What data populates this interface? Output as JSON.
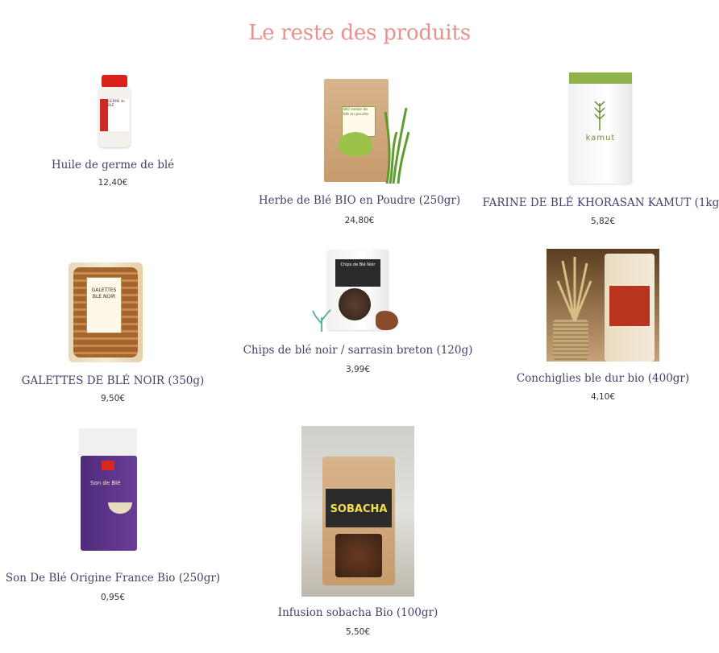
{
  "section": {
    "title": "Le reste des produits"
  },
  "products": [
    {
      "name": "Huile de germe de blé",
      "price": "12,40€",
      "image_label": "GERME de BLÉ"
    },
    {
      "name": "Herbe de Blé BIO en Poudre (250gr)",
      "price": "24,80€",
      "image_label": "BIO Herbe de blé en poudre"
    },
    {
      "name": "FARINE DE BLÉ KHORASAN KAMUT (1kg)",
      "price": "5,82€",
      "image_label": "kamut"
    },
    {
      "name": "GALETTES DE BLÉ NOIR (350g)",
      "price": "9,50€",
      "image_label": "GALETTES BLE NOIR"
    },
    {
      "name": "Chips de blé noir / sarrasin breton (120g)",
      "price": "3,99€",
      "image_label": "Chips de Blé Noir"
    },
    {
      "name": "Conchiglies ble dur bio (400gr)",
      "price": "4,10€",
      "image_label": ""
    },
    {
      "name": "Son De Blé Origine France Bio (250gr)",
      "price": "0,95€",
      "image_label": "Son de Blé"
    },
    {
      "name": "Infusion sobacha Bio (100gr)",
      "price": "5,50€",
      "image_label": "SOBACHA"
    }
  ],
  "colors": {
    "title": "#e8928c",
    "product_name": "#43436a",
    "price": "#333333"
  }
}
